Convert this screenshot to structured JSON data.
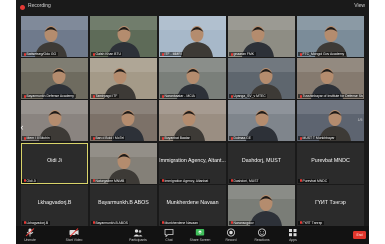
{
  "window": {
    "recording_label": "Recording",
    "view_label": "View"
  },
  "tiles": [
    {
      "name": "Battsetseg/Gdu GG",
      "kind": "video",
      "tone": "#6f7a8c"
    },
    {
      "name": "Galsh Khan BTU",
      "kind": "video",
      "tone": "#5e6b58"
    },
    {
      "name": "ITF - MMRI",
      "kind": "video",
      "tone": "#a7b8c9"
    },
    {
      "name": "gnaaran FMK",
      "kind": "video",
      "tone": "#8e8d84"
    },
    {
      "name": "FTC_Mongol Gov Academy",
      "kind": "video",
      "tone": "#7b8c99"
    },
    {
      "name": "Bayarmunkh Defense Academy",
      "kind": "video",
      "tone": "#6e6b5f"
    },
    {
      "name": "Tamirpagd ITF",
      "kind": "video",
      "tone": "#a49a88"
    },
    {
      "name": "Naranbaatar - MCIA",
      "kind": "video",
      "tone": "#7a7f7a"
    },
    {
      "name": "Uyanga_SV_v MTEC",
      "kind": "video",
      "tone": "#5e666e"
    },
    {
      "name": "Tuvshinbayar of Institute for Defense Studies",
      "kind": "video",
      "tone": "#857a6f"
    },
    {
      "name": "Mem / Il Bitchin",
      "kind": "video",
      "tone": "#8a8480"
    },
    {
      "name": "Ban d Bold / MoTel",
      "kind": "video",
      "tone": "#7c7168"
    },
    {
      "name": "Buyanbat Baatar",
      "kind": "video",
      "tone": "#9a8e82"
    },
    {
      "name": "Dulmaa.GE",
      "kind": "video",
      "tone": "#7f858c"
    },
    {
      "name": "MUST T Munkhbayar",
      "kind": "video",
      "tone": "#5d6470"
    },
    {
      "name": "Oidi Ji",
      "label": "Oidi Ji",
      "kind": "name",
      "active": true
    },
    {
      "name": "Naturgalimr MNMB",
      "kind": "video",
      "tone": "#848078"
    },
    {
      "name": "Immigration Agency, Altanbat",
      "label": "Immigration Agency, Altant...",
      "kind": "name"
    },
    {
      "name": "Dashdori, MUST",
      "label": "Dashdorj, MUST",
      "kind": "name"
    },
    {
      "name": "Purevbat MNDC",
      "label": "Purevbat MNDC",
      "kind": "name"
    },
    {
      "name": "Lkhagvadorj.B",
      "label": "Lkhagvadorj.B",
      "kind": "name"
    },
    {
      "name": "Bayarmunkh.B ABOS",
      "label": "Bayarmunkh.B ABOS",
      "kind": "name"
    },
    {
      "name": "Munkherdene Navaan",
      "label": "Munkherdene Navaan",
      "kind": "name"
    },
    {
      "name": "Naransogdov",
      "kind": "video",
      "tone": "#7a7d77"
    },
    {
      "name": "ГҮЙТ Тэнгэр",
      "label": "ГҮЙТ Тэнгэр",
      "kind": "name"
    }
  ],
  "nav": {
    "prev_arrow": "‹",
    "page_indicator": "1/5"
  },
  "toolbar": {
    "items": [
      {
        "label": "Unmute",
        "icon": "microphone-icon"
      },
      {
        "label": "Start Video",
        "icon": "video-camera-icon"
      },
      {
        "label": "Participants",
        "icon": "participants-icon"
      },
      {
        "label": "Chat",
        "icon": "chat-icon"
      },
      {
        "label": "Share Screen",
        "icon": "share-screen-icon"
      },
      {
        "label": "Record",
        "icon": "record-icon"
      },
      {
        "label": "Reactions",
        "icon": "reactions-icon"
      },
      {
        "label": "Apps",
        "icon": "apps-icon"
      }
    ],
    "end_label": "End"
  },
  "colors": {
    "active_speaker_border": "#d9d46a",
    "end_button": "#e0362c",
    "share_screen_icon": "#3fbf5a"
  }
}
